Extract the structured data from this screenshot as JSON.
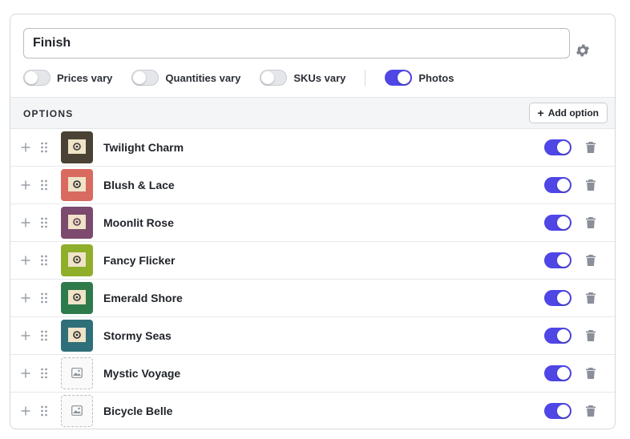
{
  "variant": {
    "name_value": "Finish",
    "settings_icon": "gear-icon"
  },
  "toggles": [
    {
      "label": "Prices vary",
      "on": false
    },
    {
      "label": "Quantities vary",
      "on": false
    },
    {
      "label": "SKUs vary",
      "on": false
    },
    {
      "label": "Photos",
      "on": true
    }
  ],
  "options_header": {
    "title": "OPTIONS",
    "add_label": "Add option"
  },
  "options": [
    {
      "name": "Twilight Charm",
      "enabled": true,
      "has_photo": true,
      "frame_color": "#4a4234",
      "art_color": "#3a3a3a"
    },
    {
      "name": "Blush & Lace",
      "enabled": true,
      "has_photo": true,
      "frame_color": "#d96a5f",
      "art_color": "#2e2e2e"
    },
    {
      "name": "Moonlit Rose",
      "enabled": true,
      "has_photo": true,
      "frame_color": "#7b4a6e",
      "art_color": "#5b3b52"
    },
    {
      "name": "Fancy Flicker",
      "enabled": true,
      "has_photo": true,
      "frame_color": "#8fae2a",
      "art_color": "#3a3a2a"
    },
    {
      "name": "Emerald Shore",
      "enabled": true,
      "has_photo": true,
      "frame_color": "#2f7a4a",
      "art_color": "#333333"
    },
    {
      "name": "Stormy Seas",
      "enabled": true,
      "has_photo": true,
      "frame_color": "#2f6f7a",
      "art_color": "#2b2b2b"
    },
    {
      "name": "Mystic Voyage",
      "enabled": true,
      "has_photo": false
    },
    {
      "name": "Bicycle Belle",
      "enabled": true,
      "has_photo": false
    }
  ],
  "colors": {
    "accent": "#4f46e5",
    "toggle_off": "#e4e6ea",
    "header_bg": "#f4f5f7",
    "icon_gray": "#8a8f98"
  }
}
